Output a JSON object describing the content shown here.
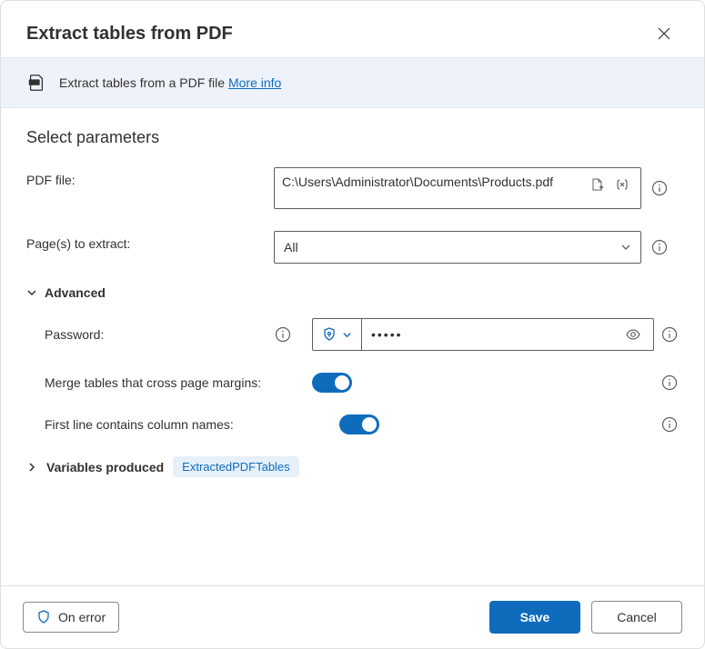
{
  "dialog": {
    "title": "Extract tables from PDF"
  },
  "banner": {
    "description": "Extract tables from a PDF file ",
    "link_text": "More info"
  },
  "section": {
    "title": "Select parameters"
  },
  "fields": {
    "pdf_file": {
      "label": "PDF file:",
      "value": "C:\\Users\\Administrator\\Documents\\Products.pdf"
    },
    "pages": {
      "label": "Page(s) to extract:",
      "value": "All"
    }
  },
  "advanced": {
    "label": "Advanced",
    "password": {
      "label": "Password:",
      "value": "•••••"
    },
    "merge": {
      "label": "Merge tables that cross page margins:"
    },
    "first_line": {
      "label": "First line contains column names:"
    }
  },
  "variables": {
    "label": "Variables produced",
    "items": [
      "ExtractedPDFTables"
    ]
  },
  "footer": {
    "on_error": "On error",
    "save": "Save",
    "cancel": "Cancel"
  }
}
